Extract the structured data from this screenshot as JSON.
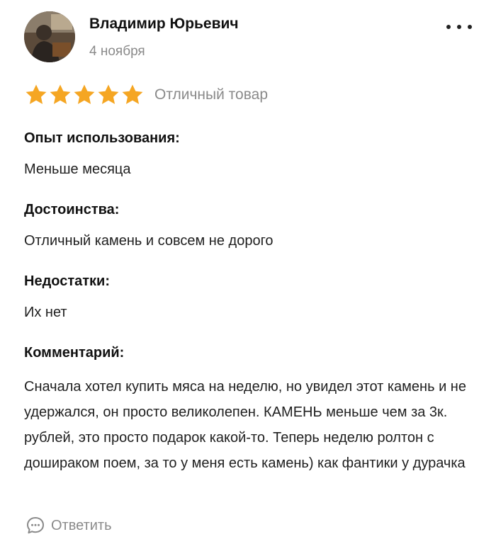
{
  "review": {
    "author": "Владимир Юрьевич",
    "date": "4 ноября",
    "rating": 5,
    "rating_max": 5,
    "rating_text": "Отличный товар",
    "sections": [
      {
        "title": "Опыт использования:",
        "text": "Меньше месяца"
      },
      {
        "title": "Достоинства:",
        "text": "Отличный камень и совсем не дорого"
      },
      {
        "title": "Недостатки:",
        "text": "Их нет"
      },
      {
        "title": "Комментарий:",
        "text": "Сначала хотел купить мяса на неделю, но увидел этот камень и не удержался, он просто великолепен. КАМЕНЬ меньше чем за 3к. рублей, это просто подарок какой-то. Теперь неделю ролтон с дошираком поем, за то у меня есть камень) как фантики у дурачка"
      }
    ],
    "reply_label": "Ответить"
  },
  "icons": {
    "more": "more-dots-icon",
    "star": "star-icon",
    "reply": "speech-bubble-icon"
  },
  "colors": {
    "star": "#f5a623",
    "muted_text": "#8a8a8a",
    "text": "#1f1f1f"
  }
}
